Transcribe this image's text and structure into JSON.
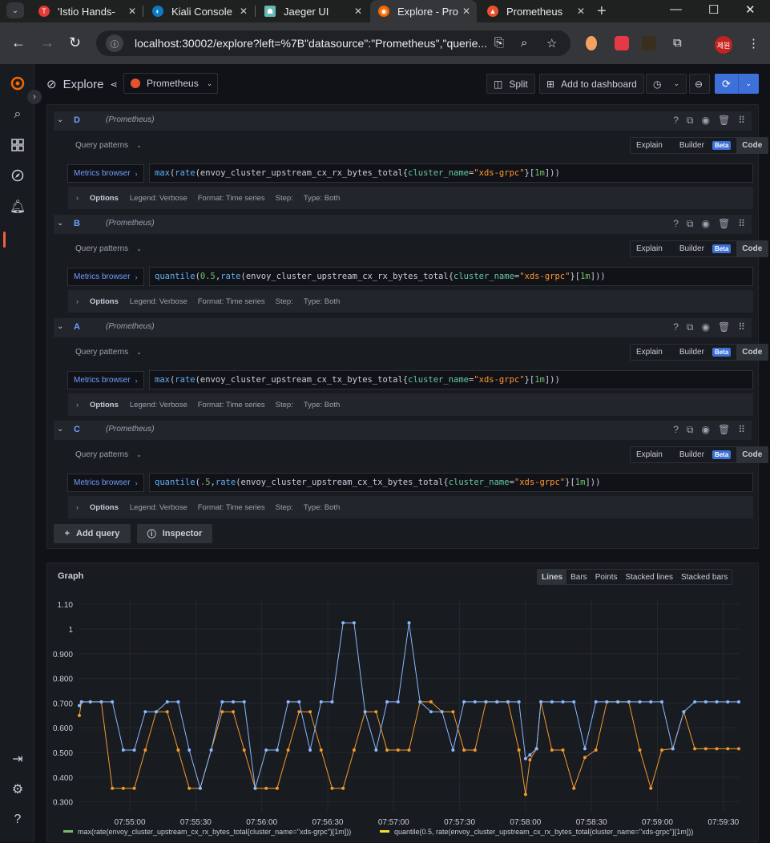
{
  "browser": {
    "tabs": [
      {
        "title": "'Istio Hands-",
        "color": "#e53935",
        "active": false
      },
      {
        "title": "Kiali Console",
        "color": "#0e7ac4",
        "active": false
      },
      {
        "title": "Jaeger UI",
        "color": "#66b8b5",
        "active": false
      },
      {
        "title": "Explore - Pro",
        "color": "#f46800",
        "active": true
      },
      {
        "title": "Prometheus",
        "color": "#e6522c",
        "active": false
      }
    ],
    "url": "localhost:30002/explore?left=%7B\"datasource\":\"Prometheus\",\"querie...",
    "avatar_text": "제원"
  },
  "explore": {
    "title": "Explore",
    "datasource": "Prometheus",
    "split_label": "Split",
    "add_dashboard_label": "Add to dashboard"
  },
  "queries": [
    {
      "ref": "D",
      "ds": "(Prometheus)",
      "tokens": [
        [
          "fn",
          "max"
        ],
        [
          "p",
          "("
        ],
        [
          "fn",
          "rate"
        ],
        [
          "p",
          "("
        ],
        [
          "p",
          "envoy_cluster_upstream_cx_rx_bytes_total"
        ],
        [
          "p",
          "{"
        ],
        [
          "lbl",
          "cluster_name"
        ],
        [
          "op",
          "="
        ],
        [
          "str",
          "\"xds-grpc\""
        ],
        [
          "p",
          "}"
        ],
        [
          "p",
          "["
        ],
        [
          "num",
          "1m"
        ],
        [
          "p",
          "]))"
        ]
      ]
    },
    {
      "ref": "B",
      "ds": "(Prometheus)",
      "tokens": [
        [
          "fn",
          "quantile"
        ],
        [
          "p",
          "("
        ],
        [
          "num",
          "0.5"
        ],
        [
          "p",
          ", "
        ],
        [
          "fn",
          "rate"
        ],
        [
          "p",
          "("
        ],
        [
          "p",
          "envoy_cluster_upstream_cx_rx_bytes_total"
        ],
        [
          "p",
          "{"
        ],
        [
          "lbl",
          "cluster_name"
        ],
        [
          "op",
          "="
        ],
        [
          "str",
          "\"xds-grpc\""
        ],
        [
          "p",
          "}"
        ],
        [
          "p",
          "["
        ],
        [
          "num",
          "1m"
        ],
        [
          "p",
          "]))"
        ]
      ]
    },
    {
      "ref": "A",
      "ds": "(Prometheus)",
      "tokens": [
        [
          "fn",
          "max"
        ],
        [
          "p",
          "("
        ],
        [
          "fn",
          "rate"
        ],
        [
          "p",
          "("
        ],
        [
          "p",
          "envoy_cluster_upstream_cx_tx_bytes_total"
        ],
        [
          "p",
          "{"
        ],
        [
          "lbl",
          "cluster_name"
        ],
        [
          "op",
          "="
        ],
        [
          "str",
          "\"xds-grpc\""
        ],
        [
          "p",
          "}"
        ],
        [
          "p",
          "["
        ],
        [
          "num",
          "1m"
        ],
        [
          "p",
          "]))"
        ]
      ]
    },
    {
      "ref": "C",
      "ds": "(Prometheus)",
      "tokens": [
        [
          "fn",
          "quantile"
        ],
        [
          "p",
          "("
        ],
        [
          "num",
          ".5"
        ],
        [
          "p",
          ", "
        ],
        [
          "fn",
          "rate"
        ],
        [
          "p",
          "("
        ],
        [
          "p",
          "envoy_cluster_upstream_cx_tx_bytes_total"
        ],
        [
          "p",
          "{"
        ],
        [
          "lbl",
          "cluster_name"
        ],
        [
          "op",
          "="
        ],
        [
          "str",
          "\"xds-grpc\""
        ],
        [
          "p",
          "}"
        ],
        [
          "p",
          "["
        ],
        [
          "num",
          "1m"
        ],
        [
          "p",
          "]))"
        ]
      ]
    }
  ],
  "query_ui": {
    "patterns": "Query patterns",
    "explain": "Explain",
    "builder": "Builder",
    "beta": "Beta",
    "code": "Code",
    "metrics_browser": "Metrics browser",
    "options": "Options",
    "legend": "Legend: Verbose",
    "format": "Format: Time series",
    "step": "Step:",
    "type": "Type: Both",
    "add_query": "Add query",
    "inspector": "Inspector"
  },
  "graph": {
    "title": "Graph",
    "types": [
      "Lines",
      "Bars",
      "Points",
      "Stacked lines",
      "Stacked bars"
    ],
    "selected_type": "Lines"
  },
  "chart_data": {
    "type": "line",
    "ylim": [
      0.26,
      1.12
    ],
    "yticks": [
      "1.10",
      "1",
      "0.900",
      "0.800",
      "0.700",
      "0.600",
      "0.500",
      "0.400",
      "0.300"
    ],
    "ytick_values": [
      1.1,
      1.0,
      0.9,
      0.8,
      0.7,
      0.6,
      0.5,
      0.4,
      0.3
    ],
    "xticks": [
      "07:55:00",
      "07:55:30",
      "07:56:00",
      "07:56:30",
      "07:57:00",
      "07:57:30",
      "07:58:00",
      "07:58:30",
      "07:59:00",
      "07:59:30"
    ],
    "xlim": [
      "07:54:37",
      "07:59:37"
    ],
    "legend_position": "bottom",
    "series": [
      {
        "name": "max(rate(envoy_cluster_upstream_cx_rx_bytes_total{cluster_name=\"xds-grpc\"}[1m]))",
        "color": "#73bf69",
        "x": [],
        "values": []
      },
      {
        "name": "quantile(0.5, rate(envoy_cluster_upstream_cx_rx_bytes_total{cluster_name=\"xds-grpc\"}[1m]))",
        "color": "#f2992e",
        "x": [
          "07:54:37",
          "07:54:38",
          "07:54:42",
          "07:54:47",
          "07:54:52",
          "07:54:57",
          "07:55:02",
          "07:55:07",
          "07:55:12",
          "07:55:17",
          "07:55:22",
          "07:55:27",
          "07:55:32",
          "07:55:37",
          "07:55:42",
          "07:55:47",
          "07:55:52",
          "07:55:57",
          "07:56:02",
          "07:56:07",
          "07:56:12",
          "07:56:17",
          "07:56:22",
          "07:56:27",
          "07:56:32",
          "07:56:37",
          "07:56:42",
          "07:56:47",
          "07:56:52",
          "07:56:57",
          "07:57:02",
          "07:57:07",
          "07:57:12",
          "07:57:17",
          "07:57:22",
          "07:57:27",
          "07:57:32",
          "07:57:37",
          "07:57:42",
          "07:57:47",
          "07:57:52",
          "07:57:57",
          "07:58:00",
          "07:58:02",
          "07:58:05",
          "07:58:07",
          "07:58:12",
          "07:58:17",
          "07:58:22",
          "07:58:27",
          "07:58:32",
          "07:58:37",
          "07:58:42",
          "07:58:47",
          "07:58:52",
          "07:58:57",
          "07:59:02",
          "07:59:07",
          "07:59:12",
          "07:59:17",
          "07:59:22",
          "07:59:27",
          "07:59:32",
          "07:59:37"
        ],
        "values": [
          0.65,
          0.705,
          0.705,
          0.705,
          0.355,
          0.355,
          0.355,
          0.51,
          0.665,
          0.665,
          0.51,
          0.355,
          0.355,
          0.51,
          0.665,
          0.665,
          0.51,
          0.355,
          0.355,
          0.355,
          0.51,
          0.665,
          0.665,
          0.51,
          0.355,
          0.355,
          0.51,
          0.665,
          0.665,
          0.51,
          0.51,
          0.51,
          0.705,
          0.705,
          0.665,
          0.665,
          0.51,
          0.51,
          0.705,
          0.705,
          0.705,
          0.51,
          0.33,
          0.47,
          0.515,
          0.705,
          0.51,
          0.51,
          0.355,
          0.48,
          0.51,
          0.705,
          0.705,
          0.705,
          0.51,
          0.355,
          0.51,
          0.515,
          0.665,
          0.515,
          0.515,
          0.515,
          0.515,
          0.515
        ]
      },
      {
        "name": "max(rate(envoy_cluster_upstream_cx_tx_bytes_total{cluster_name=\"xds-grpc\"}[1m]))",
        "color": "#8ab8ff",
        "x": [
          "07:54:37",
          "07:54:38",
          "07:54:42",
          "07:54:47",
          "07:54:52",
          "07:54:57",
          "07:55:02",
          "07:55:07",
          "07:55:12",
          "07:55:17",
          "07:55:22",
          "07:55:27",
          "07:55:32",
          "07:55:37",
          "07:55:42",
          "07:55:47",
          "07:55:52",
          "07:55:57",
          "07:56:02",
          "07:56:07",
          "07:56:12",
          "07:56:17",
          "07:56:22",
          "07:56:27",
          "07:56:32",
          "07:56:37",
          "07:56:42",
          "07:56:47",
          "07:56:52",
          "07:56:57",
          "07:57:02",
          "07:57:07",
          "07:57:12",
          "07:57:17",
          "07:57:22",
          "07:57:27",
          "07:57:32",
          "07:57:37",
          "07:57:42",
          "07:57:47",
          "07:57:52",
          "07:57:57",
          "07:58:00",
          "07:58:02",
          "07:58:05",
          "07:58:07",
          "07:58:12",
          "07:58:17",
          "07:58:22",
          "07:58:27",
          "07:58:32",
          "07:58:37",
          "07:58:42",
          "07:58:47",
          "07:58:52",
          "07:58:57",
          "07:59:02",
          "07:59:07",
          "07:59:12",
          "07:59:17",
          "07:59:22",
          "07:59:27",
          "07:59:32",
          "07:59:37"
        ],
        "values": [
          0.69,
          0.705,
          0.705,
          0.705,
          0.705,
          0.51,
          0.51,
          0.665,
          0.665,
          0.705,
          0.705,
          0.51,
          0.355,
          0.51,
          0.705,
          0.705,
          0.705,
          0.355,
          0.51,
          0.51,
          0.705,
          0.705,
          0.51,
          0.705,
          0.705,
          1.025,
          1.025,
          0.665,
          0.51,
          0.705,
          0.705,
          1.025,
          0.705,
          0.665,
          0.665,
          0.51,
          0.705,
          0.705,
          0.705,
          0.705,
          0.705,
          0.705,
          0.475,
          0.49,
          0.515,
          0.705,
          0.705,
          0.705,
          0.705,
          0.515,
          0.705,
          0.705,
          0.705,
          0.705,
          0.705,
          0.705,
          0.705,
          0.515,
          0.665,
          0.705,
          0.705,
          0.705,
          0.705,
          0.705
        ]
      },
      {
        "name": "quantile(.5, rate(envoy_cluster_upstream_cx_tx_bytes_total{cluster_name=\"xds-grpc\"}[1m]))",
        "color": "#f2992e",
        "x": [],
        "values": []
      }
    ],
    "visible_legend": [
      {
        "name": "max(rate(envoy_cluster_upstream_cx_rx_bytes_total{cluster_name=\"xds-grpc\"}[1m]))",
        "color": "#73bf69"
      },
      {
        "name": "quantile(0.5, rate(envoy_cluster_upstream_cx_rx_bytes_total{cluster_name=\"xds-grpc\"}[1m]))",
        "color": "#fade2a"
      }
    ]
  }
}
